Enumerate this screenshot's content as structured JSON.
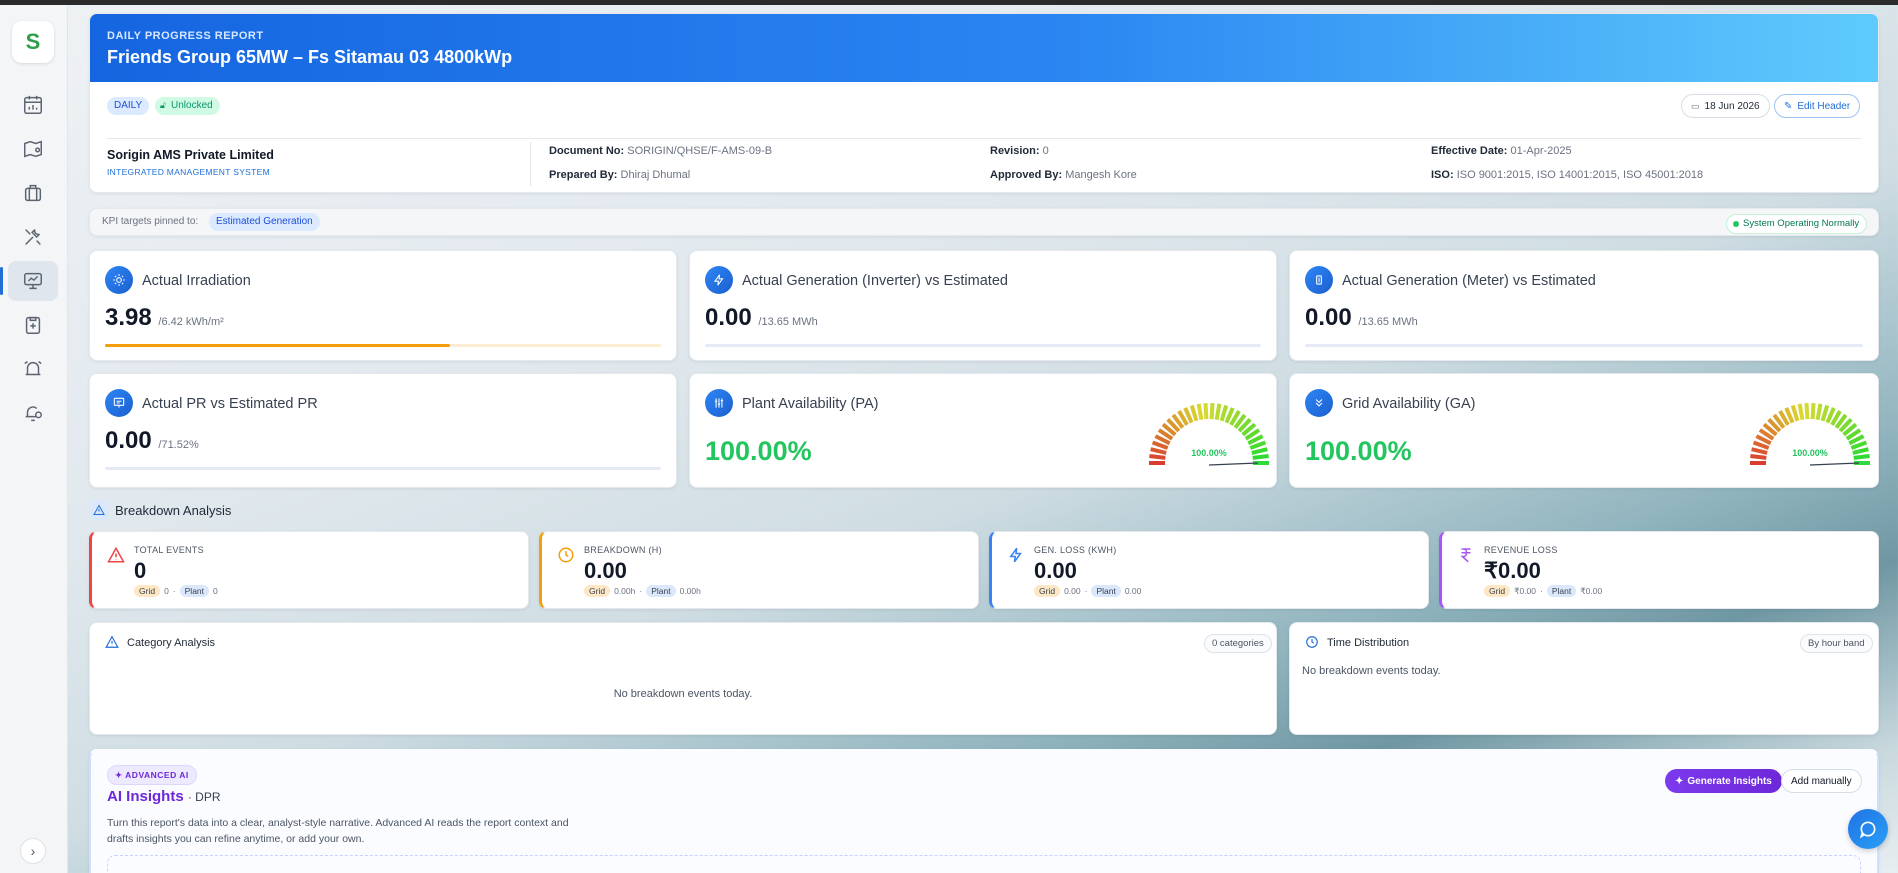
{
  "report": {
    "subtitle": "DAILY PROGRESS REPORT",
    "title": "Friends Group 65MW – Fs Sitamau 03 4800kWp",
    "badge_daily": "DAILY",
    "badge_lock": "Unlocked",
    "date": "18 Jun 2026",
    "edit_header": "Edit Header"
  },
  "company": {
    "name": "Sorigin AMS Private Limited",
    "system": "INTEGRATED MANAGEMENT SYSTEM"
  },
  "meta": {
    "doc_no_label": "Document No:",
    "doc_no": "SORIGIN/QHSE/F-AMS-09-B",
    "revision_label": "Revision:",
    "revision": "0",
    "effective_label": "Effective Date:",
    "effective": "01-Apr-2025",
    "prepared_label": "Prepared By:",
    "prepared": "Dhiraj Dhumal",
    "approved_label": "Approved By:",
    "approved": "Mangesh Kore",
    "iso_label": "ISO:",
    "iso": "ISO 9001:2015, ISO 14001:2015, ISO 45001:2018"
  },
  "kpi_targets": {
    "label": "KPI targets pinned to:",
    "target": "Estimated Generation",
    "status": "System Operating Normally"
  },
  "kpis": {
    "irradiation": {
      "label": "Actual Irradiation",
      "value": "3.98",
      "unit": "/6.42 kWh/m²",
      "progress": 0.62
    },
    "inverter": {
      "label": "Actual Generation (Inverter) vs Estimated",
      "value": "0.00",
      "unit": "/13.65 MWh",
      "progress": 0
    },
    "meter": {
      "label": "Actual Generation (Meter) vs Estimated",
      "value": "0.00",
      "unit": "/13.65 MWh",
      "progress": 0
    },
    "pr": {
      "label": "Actual PR vs Estimated PR",
      "value": "0.00",
      "unit": "/71.52%",
      "progress": 0
    },
    "pa": {
      "label": "Plant Availability (PA)",
      "value": "100.00%",
      "gauge_label": "100.00%",
      "level": 1.0
    },
    "ga": {
      "label": "Grid Availability (GA)",
      "value": "100.00%",
      "gauge_label": "100.00%",
      "level": 1.0
    }
  },
  "breakdown": {
    "title": "Breakdown Analysis",
    "grid": "Grid",
    "plant": "Plant",
    "cards": [
      {
        "label": "TOTAL EVENTS",
        "value": "0",
        "grid": "0",
        "plant": "0",
        "accent": "#ef4444"
      },
      {
        "label": "BREAKDOWN (H)",
        "value": "0.00",
        "grid": "0.00h",
        "plant": "0.00h",
        "accent": "#f59e0b"
      },
      {
        "label": "GEN. LOSS (KWH)",
        "value": "0.00",
        "grid": "0.00",
        "plant": "0.00",
        "accent": "#3b82f6"
      },
      {
        "label": "REVENUE LOSS",
        "value": "₹0.00",
        "grid": "₹0.00",
        "plant": "₹0.00",
        "accent": "#a855f7"
      }
    ]
  },
  "category": {
    "title": "Category Analysis",
    "count": "0 categories",
    "empty": "No breakdown events today."
  },
  "time_dist": {
    "title": "Time Distribution",
    "mode": "By hour band",
    "empty": "No breakdown events today."
  },
  "ai": {
    "badge": "ADVANCED AI",
    "title": "AI Insights",
    "suffix": "· DPR",
    "desc1": "Turn this report's data into a clear, analyst-style narrative. Advanced AI reads the report context and",
    "desc2": "drafts insights you can refine anytime, or add your own.",
    "generate": "Generate Insights",
    "add": "Add manually"
  },
  "colors": {
    "accent": "#1f6fd6",
    "success": "#22c55e",
    "ai_purple": "#7c3aed"
  }
}
